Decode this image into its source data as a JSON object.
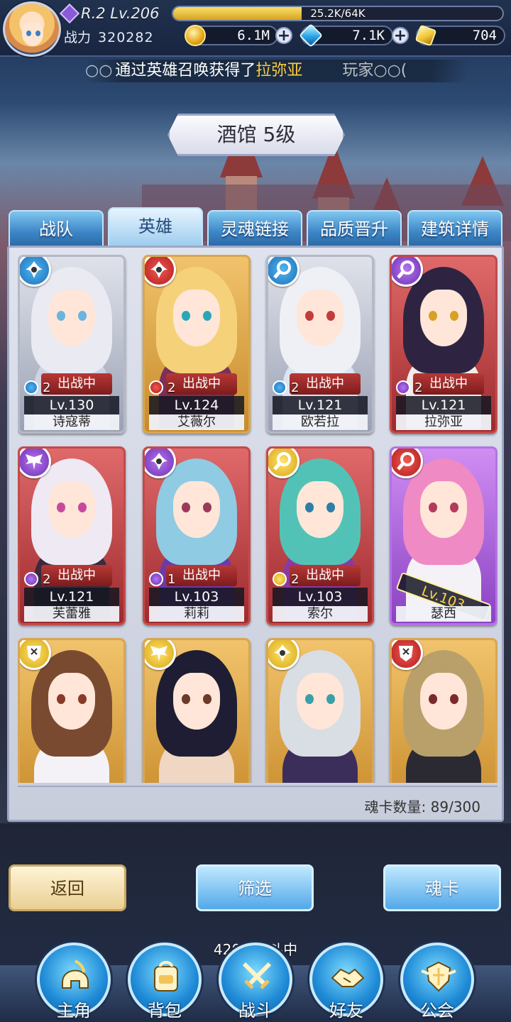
{
  "player": {
    "rank_level": "R.2 Lv.206",
    "exp_text": "25.2K/64K",
    "exp_fraction": 0.39,
    "power_label": "战力",
    "power_value": "320282"
  },
  "resources": {
    "coins": "6.1M",
    "crystals": "7.1K",
    "gold_bars": "704"
  },
  "marquee": {
    "prefix": "○○",
    "text": "通过英雄召唤获得了",
    "hero": "拉弥亚",
    "tail": "玩家○○("
  },
  "title": "酒馆 5级",
  "tabs": [
    {
      "label": "战队"
    },
    {
      "label": "英雄"
    },
    {
      "label": "灵魂链接"
    },
    {
      "label": "品质晋升"
    },
    {
      "label": "建筑详情"
    }
  ],
  "cards": [
    {
      "name": "诗寇蒂",
      "level": "Lv.130",
      "stars": "2",
      "status": "出战中",
      "rarity": "silver",
      "element": "blue-shuriken",
      "hair": "#e9eaf2",
      "eye": "#6ab4e0",
      "cloth": "#cfd3e2"
    },
    {
      "name": "艾薇尔",
      "level": "Lv.124",
      "stars": "2",
      "status": "出战中",
      "rarity": "gold",
      "element": "red-shuriken",
      "hair": "#f5d27a",
      "eye": "#2aa7b7",
      "cloth": "#7b2f5a"
    },
    {
      "name": "欧若拉",
      "level": "Lv.121",
      "stars": "2",
      "status": "出战中",
      "rarity": "silver",
      "element": "blue-magnifier",
      "hair": "#eef0f5",
      "eye": "#c43b3b",
      "cloth": "#dce4f0"
    },
    {
      "name": "拉弥亚",
      "level": "Lv.121",
      "stars": "2",
      "status": "出战中",
      "rarity": "red",
      "element": "purple-magnifier",
      "hair": "#2e2442",
      "eye": "#d9a024",
      "cloth": "#f2ece8"
    },
    {
      "name": "芙蕾雅",
      "level": "Lv.121",
      "stars": "2",
      "status": "出战中",
      "rarity": "red",
      "element": "purple-wings",
      "hair": "#efe9f4",
      "eye": "#c54a9e",
      "cloth": "#3a2a3d"
    },
    {
      "name": "莉莉",
      "level": "Lv.103",
      "stars": "1",
      "status": "出战中",
      "rarity": "red",
      "element": "purple-shuriken",
      "hair": "#8fcbe3",
      "eye": "#9a3a5a",
      "cloth": "#6b3aa8"
    },
    {
      "name": "索尔",
      "level": "Lv.103",
      "stars": "2",
      "status": "出战中",
      "rarity": "red",
      "element": "yellow-magnifier",
      "hair": "#53c2b6",
      "eye": "#2d7ea8",
      "cloth": "#8b3aa0"
    },
    {
      "name": "瑟西",
      "level": "Lv.103",
      "stars": "",
      "status": "",
      "rarity": "purple",
      "element": "red-magnifier",
      "hair": "#f08ac4",
      "eye": "#b23a5a",
      "cloth": "#f4f2f6"
    },
    {
      "name": "",
      "level": "",
      "stars": "",
      "status": "",
      "rarity": "gold",
      "element": "yellow-shield",
      "hair": "#7a4a30",
      "eye": "#8a3a2a",
      "cloth": "#f4f2f6"
    },
    {
      "name": "",
      "level": "",
      "stars": "",
      "status": "",
      "rarity": "gold",
      "element": "yellow-wings",
      "hair": "#1f1d33",
      "eye": "#6b3a2a",
      "cloth": "#efd7c4"
    },
    {
      "name": "",
      "level": "",
      "stars": "",
      "status": "",
      "rarity": "gold",
      "element": "yellow-shuriken",
      "hair": "#d9dde4",
      "eye": "#3aa0a8",
      "cloth": "#3c2e5a"
    },
    {
      "name": "",
      "level": "",
      "stars": "",
      "status": "",
      "rarity": "gold",
      "element": "red-shield",
      "hair": "#b9a06a",
      "eye": "#7a2a2a",
      "cloth": "#2b2a33"
    }
  ],
  "soul_card_count": "魂卡数量: 89/300",
  "buttons": {
    "back": "返回",
    "filter": "筛选",
    "soul_card": "魂卡"
  },
  "battle_status": "420层战斗中",
  "nav": [
    {
      "label": "主角",
      "icon": "helmet-icon"
    },
    {
      "label": "背包",
      "icon": "backpack-icon"
    },
    {
      "label": "战斗",
      "icon": "crossed-swords-icon"
    },
    {
      "label": "好友",
      "icon": "handshake-icon"
    },
    {
      "label": "公会",
      "icon": "guild-emblem-icon"
    }
  ]
}
